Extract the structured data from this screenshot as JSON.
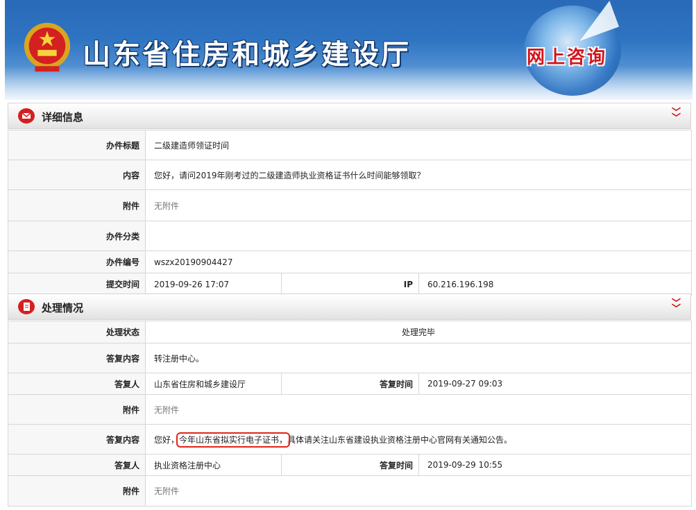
{
  "header": {
    "site_title": "山东省住房和城乡建设厅",
    "badge": "网上咨询"
  },
  "detail": {
    "section_title": "详细信息",
    "rows": {
      "title_label": "办件标题",
      "title_value": "二级建造师领证时间",
      "content_label": "内容",
      "content_value": "您好，请问2019年刚考过的二级建造师执业资格证书什么时间能够领取？",
      "attach_label": "附件",
      "attach_value": "无附件",
      "category_label": "办件分类",
      "category_value": "",
      "number_label": "办件编号",
      "number_value": "wszx20190904427",
      "time_label": "提交时间",
      "time_value": "2019-09-26 17:07",
      "ip_label": "IP",
      "ip_value": "60.216.196.198"
    }
  },
  "process": {
    "section_title": "处理情况",
    "status_label": "处理状态",
    "status_value": "处理完毕",
    "reply1": {
      "content_label": "答复内容",
      "content_value": "转注册中心。",
      "replier_label": "答复人",
      "replier_value": "山东省住房和城乡建设厅",
      "time_label": "答复时间",
      "time_value": "2019-09-27 09:03",
      "attach_label": "附件",
      "attach_value": "无附件"
    },
    "reply2": {
      "content_label": "答复内容",
      "content_prefix": "您好，",
      "content_highlight": "今年山东省拟实行电子证书，",
      "content_suffix": "具体请关注山东省建设执业资格注册中心官网有关通知公告。",
      "replier_label": "答复人",
      "replier_value": "执业资格注册中心",
      "time_label": "答复时间",
      "time_value": "2019-09-29 10:55",
      "attach_label": "附件",
      "attach_value": "无附件"
    }
  },
  "colors": {
    "banner_blue": "#2e74c2",
    "highlight_red": "#e2231a",
    "icon_red": "#d42020"
  },
  "icons": {
    "emblem": "national-emblem-icon",
    "mail": "mail-icon",
    "doc": "document-icon",
    "collapse": "double-chevron-down-icon"
  }
}
